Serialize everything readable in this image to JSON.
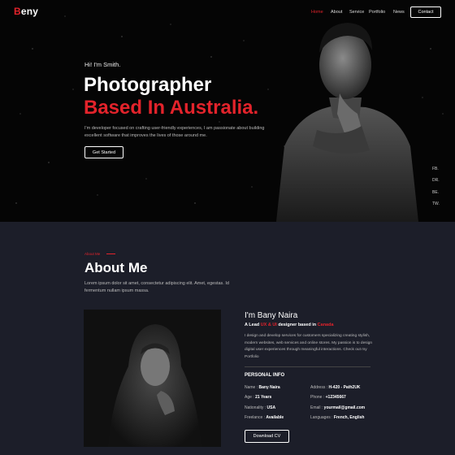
{
  "nav": {
    "logo_initial": "B",
    "logo_rest": "eny",
    "items": [
      "Home",
      "About",
      "Service",
      "Portfolio",
      "News"
    ],
    "contact_label": "Contact"
  },
  "hero": {
    "greeting": "Hi! I'm Smith.",
    "title_line1": "Photographer",
    "title_line2": "Based In Australia.",
    "intro": "I'm developer focused on crafting user-friendly experiences, I am passionate about building excellent software that improves the lives of those around me.",
    "cta_label": "Get Started"
  },
  "social": [
    "FB.",
    "DR.",
    "BE.",
    "TW."
  ],
  "about": {
    "tag": "About Me",
    "heading": "About Me",
    "intro": "Lorem ipsum dolor sit amet, consectetur adipiscing elit. Amet, egestas. Id fermentum nullam ipsum massa.",
    "name": "I'm Bany Naira",
    "role_prefix": "A Lead",
    "role_skill": "UX & UI",
    "role_mid": "designer based in",
    "role_place": "Canada",
    "bio": "I design and develop services for customers specializing creating stylish, modern websites, web services and online stores. My passion is to design digital user experiences through meaningful interactions. Check out my Portfolio",
    "personal_info_title": "PERSONAL INFO",
    "info": [
      {
        "label": "Name : ",
        "value": "Bany Naira"
      },
      {
        "label": "Address : ",
        "value": "H-420 - Path2UK"
      },
      {
        "label": "Age : ",
        "value": "21 Years"
      },
      {
        "label": "Phone : ",
        "value": "+12345667"
      },
      {
        "label": "Nationality : ",
        "value": "USA"
      },
      {
        "label": "Email : ",
        "value": "yourmail@gmail.com"
      },
      {
        "label": "Freelance : ",
        "value": "Available"
      },
      {
        "label": "Languages : ",
        "value": "French, English"
      }
    ],
    "cv_label": "Download CV"
  },
  "colors": {
    "accent": "#e3232b",
    "hero_bg": "#050505",
    "section_bg": "#1c1e29"
  }
}
